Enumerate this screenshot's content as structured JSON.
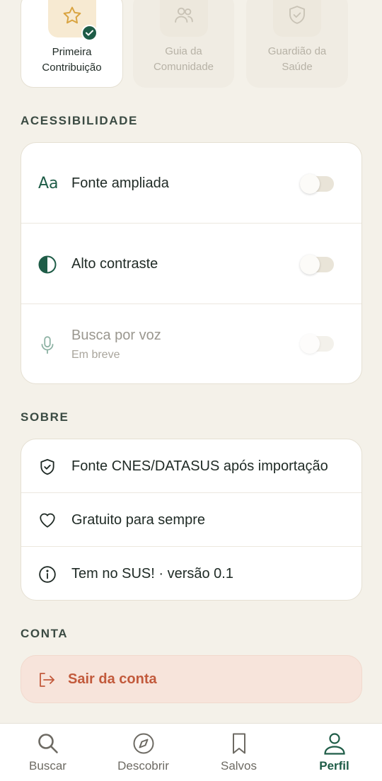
{
  "badges": [
    {
      "label_line1": "Primeira",
      "label_line2": "Contribuição",
      "icon": "star-icon",
      "earned": true
    },
    {
      "label_line1": "Guia da",
      "label_line2": "Comunidade",
      "icon": "users-icon",
      "earned": false
    },
    {
      "label_line1": "Guardião da",
      "label_line2": "Saúde",
      "icon": "shield-check-icon",
      "earned": false
    }
  ],
  "accessibility": {
    "title": "ACESSIBILIDADE",
    "items": [
      {
        "label": "Fonte ampliada",
        "icon": "font-size-icon",
        "enabled": false
      },
      {
        "label": "Alto contraste",
        "icon": "contrast-icon",
        "enabled": false
      },
      {
        "label": "Busca por voz",
        "sublabel": "Em breve",
        "icon": "microphone-icon",
        "enabled": false,
        "disabled": true
      }
    ]
  },
  "about": {
    "title": "SOBRE",
    "items": [
      {
        "label": "Fonte CNES/DATASUS após importação",
        "icon": "shield-icon"
      },
      {
        "label": "Gratuito para sempre",
        "icon": "heart-icon"
      },
      {
        "label": "Tem no SUS! · versão 0.1",
        "icon": "info-icon"
      }
    ]
  },
  "account": {
    "title": "CONTA",
    "logout_label": "Sair da conta"
  },
  "tabs": [
    {
      "label": "Buscar",
      "icon": "search-icon",
      "active": false
    },
    {
      "label": "Descobrir",
      "icon": "compass-icon",
      "active": false
    },
    {
      "label": "Salvos",
      "icon": "bookmark-icon",
      "active": false
    },
    {
      "label": "Perfil",
      "icon": "user-icon",
      "active": true
    }
  ],
  "colors": {
    "background": "#f4f1e9",
    "accent": "#1e5c47",
    "danger": "#c25a3c",
    "badge_gold": "#d9a441"
  }
}
